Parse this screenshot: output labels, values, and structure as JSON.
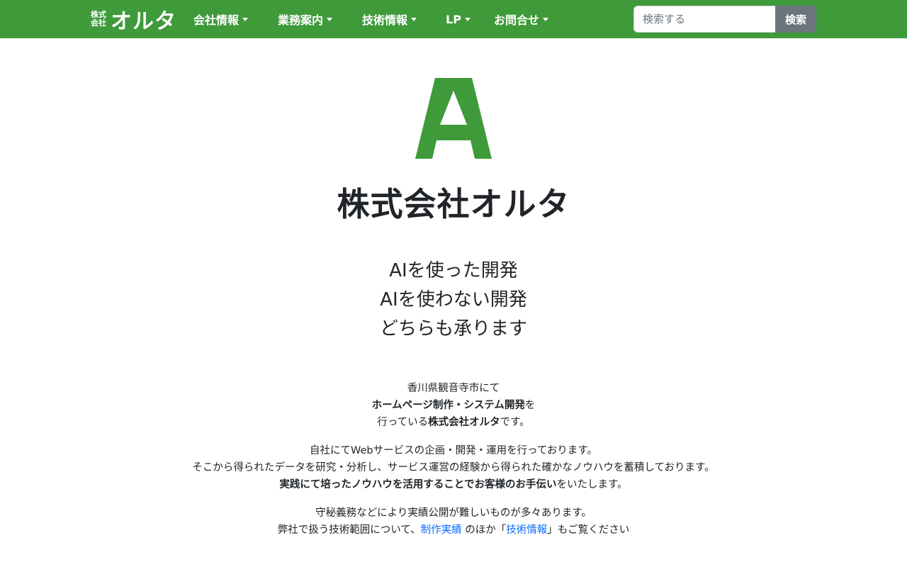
{
  "navbar": {
    "brand_small_top": "株式",
    "brand_small_bottom": "会社",
    "brand_large": "オルタ",
    "items": [
      {
        "label": "会社情報"
      },
      {
        "label": "業務案内"
      },
      {
        "label": "技術情報"
      },
      {
        "label": "LP"
      },
      {
        "label": "お問合せ"
      }
    ],
    "search": {
      "placeholder": "検索する",
      "button_label": "検索"
    }
  },
  "colors": {
    "brand_green": "#3f9a3a",
    "link_blue": "#0d6efd",
    "button_gray": "#6c757d"
  },
  "hero": {
    "logo_letter": "A",
    "title": "株式会社オルタ",
    "tagline": [
      "AIを使った開発",
      "AIを使わない開発",
      "どちらも承ります"
    ]
  },
  "intro": {
    "p1_line1": "香川県観音寺市にて",
    "p1_line2_bold": "ホームページ制作・システム開発",
    "p1_line2_rest": "を",
    "p1_line3_pre": "行っている",
    "p1_line3_bold": "株式会社オルタ",
    "p1_line3_rest": "です。",
    "p2_line1": "自社にてWebサービスの企画・開発・運用を行っております。",
    "p2_line2": "そこから得られたデータを研究・分析し、サービス運営の経験から得られた確かなノウハウを蓄積しております。",
    "p2_line3_bold": "実践にて培ったノウハウを活用することでお客様のお手伝い",
    "p2_line3_rest": "をいたします。",
    "p3_line1": "守秘義務などにより実績公開が難しいものが多々あります。",
    "p3_line2_pre": "弊社で扱う技術範囲について、",
    "p3_link1": "制作実績",
    "p3_line2_mid1": " のほか「",
    "p3_link2": "技術情報",
    "p3_line2_post": "」もご覧ください"
  }
}
